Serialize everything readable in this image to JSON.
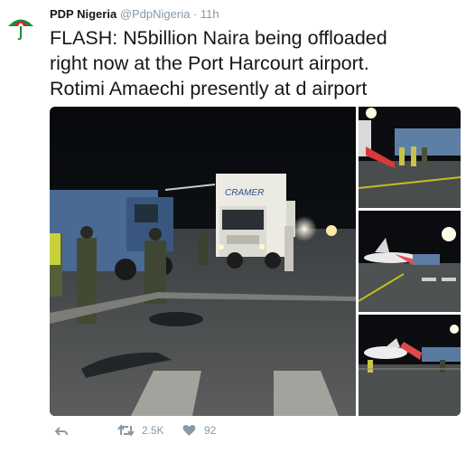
{
  "tweet": {
    "author_name": "PDP Nigeria",
    "handle": "@PdpNigeria",
    "separator": "·",
    "time": "11h",
    "text_lines": [
      "FLASH: N5billion Naira being offloaded",
      "right now at the Port Harcourt airport.",
      "Rotimi Amaechi presently at d airport"
    ]
  },
  "media": {
    "main_photo": {
      "truck_sign": "CRAMER"
    }
  },
  "actions": {
    "retweet_count": "2.5K",
    "like_count": "92"
  },
  "icons": [
    "pdp-umbrella-avatar-icon",
    "reply-icon",
    "retweet-icon",
    "heart-icon"
  ],
  "colors": {
    "accent_green": "#1b8a3a",
    "accent_red": "#d6202b",
    "muted": "#8899a6"
  }
}
